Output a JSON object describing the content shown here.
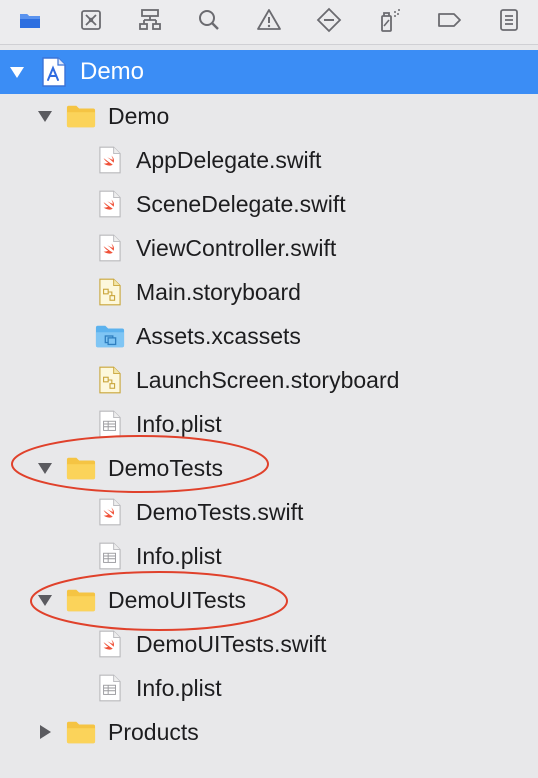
{
  "toolbar": {
    "buttons": [
      {
        "icon": "folder-icon",
        "active": true
      },
      {
        "icon": "source-control-icon"
      },
      {
        "icon": "symbol-hierarchy-icon"
      },
      {
        "icon": "search-icon"
      },
      {
        "icon": "warning-icon"
      },
      {
        "icon": "test-diamond-icon"
      },
      {
        "icon": "debug-spray-icon"
      },
      {
        "icon": "breakpoint-tag-icon"
      },
      {
        "icon": "report-list-icon"
      }
    ]
  },
  "navigator": {
    "items": [
      {
        "label": "Demo",
        "kind": "project",
        "expanded": true,
        "selected": true
      },
      {
        "label": "Demo",
        "kind": "folder",
        "expanded": true
      },
      {
        "label": "AppDelegate.swift",
        "kind": "swift"
      },
      {
        "label": "SceneDelegate.swift",
        "kind": "swift"
      },
      {
        "label": "ViewController.swift",
        "kind": "swift"
      },
      {
        "label": "Main.storyboard",
        "kind": "storyboard"
      },
      {
        "label": "Assets.xcassets",
        "kind": "assets"
      },
      {
        "label": "LaunchScreen.storyboard",
        "kind": "storyboard"
      },
      {
        "label": "Info.plist",
        "kind": "plist"
      },
      {
        "label": "DemoTests",
        "kind": "folder",
        "expanded": true,
        "circled": true
      },
      {
        "label": "DemoTests.swift",
        "kind": "swift"
      },
      {
        "label": "Info.plist",
        "kind": "plist"
      },
      {
        "label": "DemoUITests",
        "kind": "folder",
        "expanded": true,
        "circled": true
      },
      {
        "label": "DemoUITests.swift",
        "kind": "swift"
      },
      {
        "label": "Info.plist",
        "kind": "plist"
      },
      {
        "label": "Products",
        "kind": "folder",
        "expanded": false
      }
    ]
  },
  "colors": {
    "selection": "#3b8df5",
    "folder": "#f7c948",
    "swift": "#f05138",
    "annotation": "#e0412b"
  }
}
